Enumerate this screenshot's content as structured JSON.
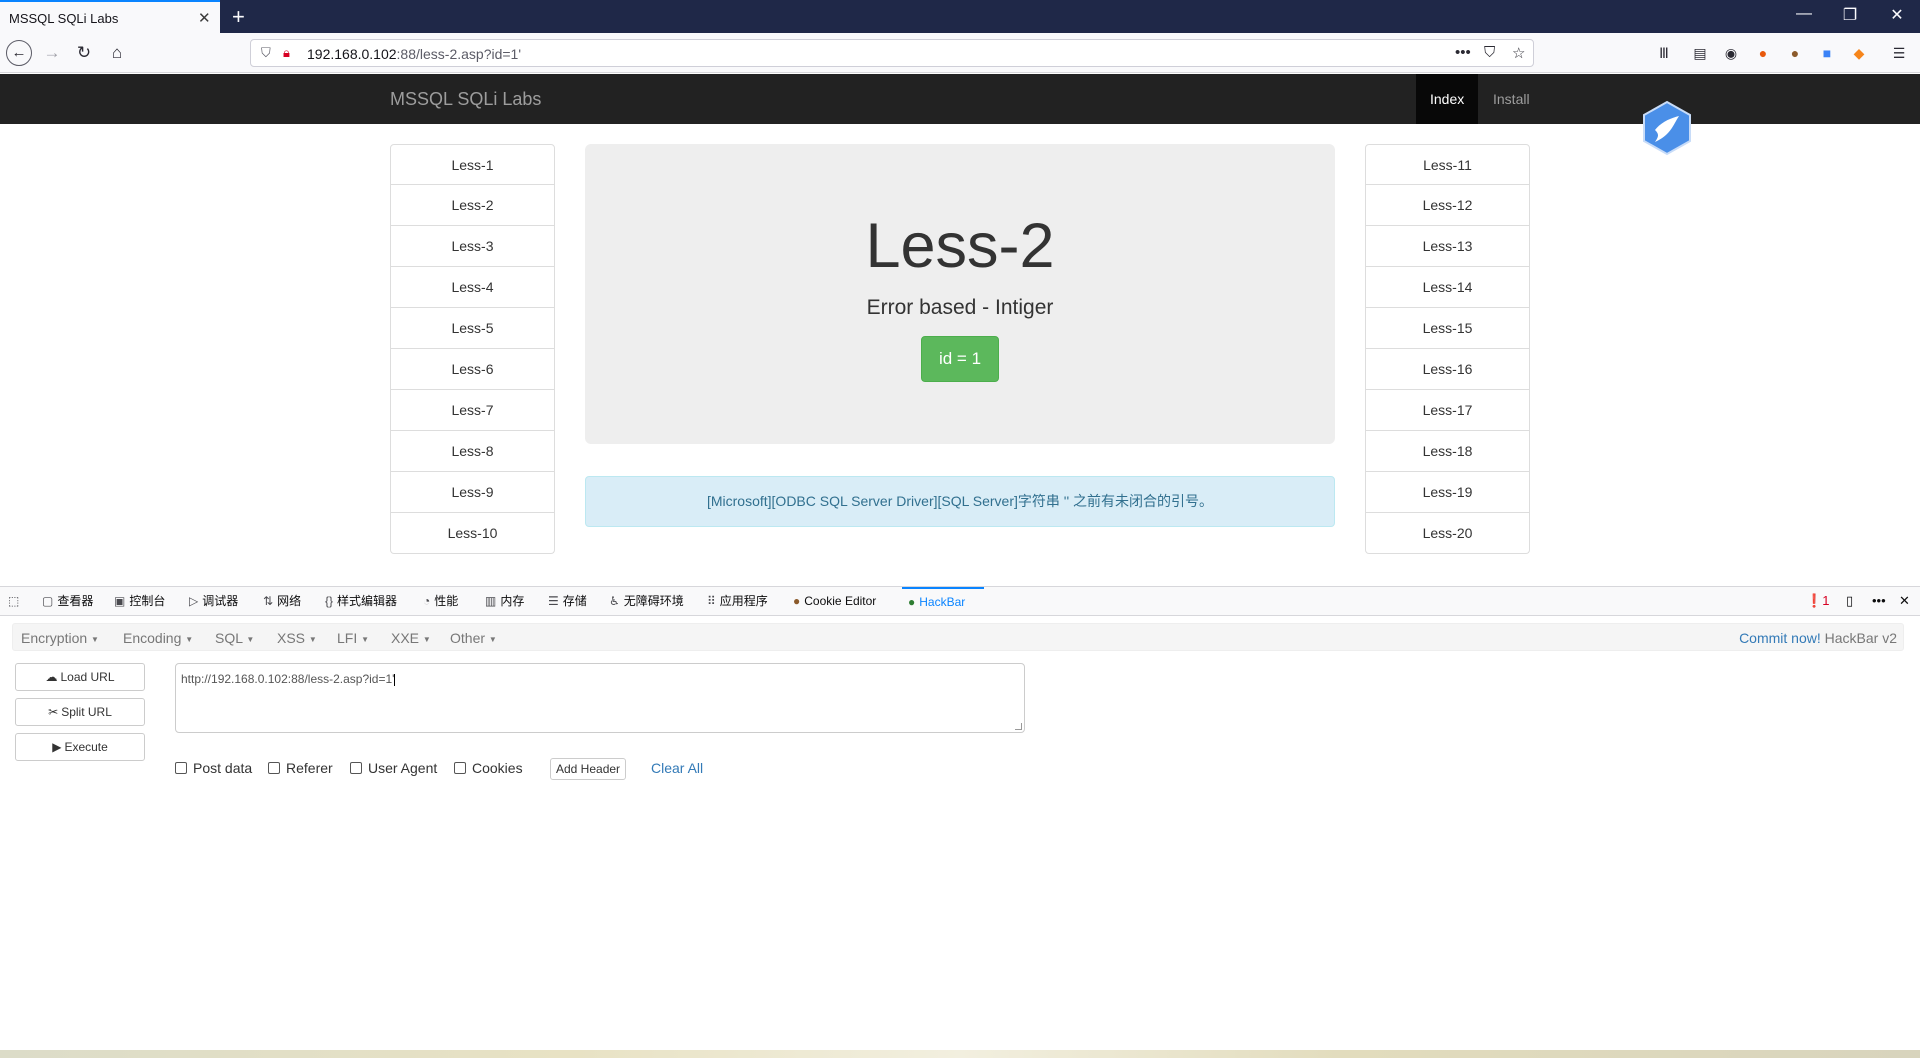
{
  "browser": {
    "tab_title": "MSSQL SQLi Labs",
    "tab_close": "✕",
    "new_tab": "+",
    "url_host": "192.168.0.102",
    "url_rest": ":88/less-2.asp?id=1'",
    "window_controls": [
      "—",
      "❐",
      "✕"
    ]
  },
  "site": {
    "brand": "MSSQL SQLi Labs",
    "nav": {
      "index": "Index",
      "install": "Install"
    },
    "left_lessons": [
      "Less-1",
      "Less-2",
      "Less-3",
      "Less-4",
      "Less-5",
      "Less-6",
      "Less-7",
      "Less-8",
      "Less-9",
      "Less-10"
    ],
    "right_lessons": [
      "Less-11",
      "Less-12",
      "Less-13",
      "Less-14",
      "Less-15",
      "Less-16",
      "Less-17",
      "Less-18",
      "Less-19",
      "Less-20"
    ],
    "title": "Less-2",
    "subtitle": "Error based - Intiger",
    "id_button": "id = 1",
    "error_message": "[Microsoft][ODBC SQL Server Driver][SQL Server]字符串 '' 之前有未闭合的引号。"
  },
  "devtools": {
    "tabs": [
      "查看器",
      "控制台",
      "调试器",
      "网络",
      "样式编辑器",
      "性能",
      "内存",
      "存储",
      "无障碍环境",
      "应用程序",
      "Cookie Editor",
      "HackBar"
    ],
    "error_count": "1"
  },
  "hackbar": {
    "menus": [
      "Encoding_placeholder"
    ],
    "menu_encryption": "Encryption",
    "menu_encoding": "Encoding",
    "menu_sql": "SQL",
    "menu_xss": "XSS",
    "menu_lfi": "LFI",
    "menu_xxe": "XXE",
    "menu_other": "Other",
    "commit_link": "Commit now!",
    "commit_text": "HackBar v2",
    "load_url": "Load URL",
    "split_url": "Split URL",
    "execute": "Execute",
    "url_value": "http://192.168.0.102:88/less-2.asp?id=1'",
    "post_data": "Post data",
    "referer": "Referer",
    "user_agent": "User Agent",
    "cookies": "Cookies",
    "add_header": "Add Header",
    "clear_all": "Clear All"
  },
  "colors": {
    "tabbar": "#1f2848",
    "site_nav": "#222222",
    "success": "#5cb85c",
    "info_bg": "#d9edf7",
    "link": "#337ab7"
  }
}
